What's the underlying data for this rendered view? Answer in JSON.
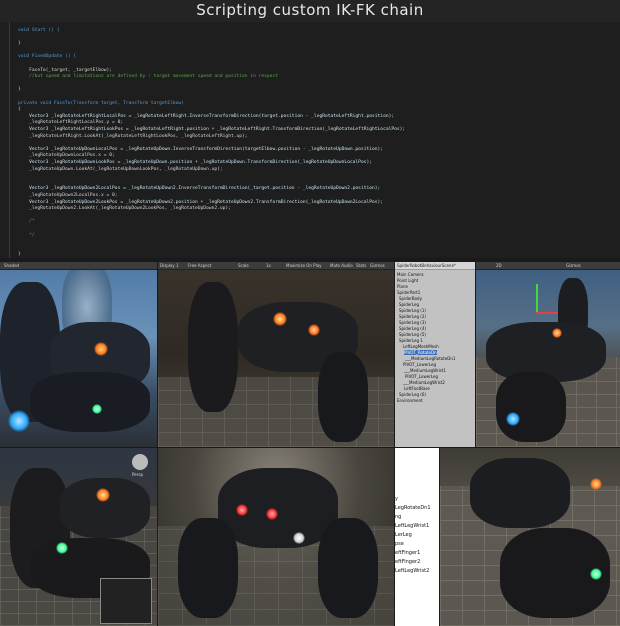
{
  "title": "Scripting custom IK-FK chain",
  "code_lines": [
    "void Start () {",
    "",
    "}",
    "",
    "void FixedUpdate () {",
    "",
    "    FaceTo(_target, _targetElbow);",
    "    //but speed and limitations are defined by : target movement speed and position in respect",
    "",
    "}",
    "",
    "private void FaceTo(Transform target, Transform targetElbow)",
    "{",
    "    Vector3 _legRotateLeftRightLocalPos = _legRotateLeftRight.InverseTransformDirection(target.position - _legRotateLeftRight.position);",
    "    _legRotateLeftRightLocalPos.y = 0;",
    "    Vector3 _legRotateLeftRightLookPos = _legRotateLeftRight.position + _legRotateLeftRight.TransformDirection(_legRotateLeftRightLocalPos);",
    "    _legRotateLeftRight.LookAt(_legRotateLeftRightLookPos, _legRotateLeftRight.up);",
    "",
    "    Vector3 _legRotateUpDownLocalPos = _legRotateUpDown.InverseTransformDirection(targetElbow.position - _legRotateUpDown.position);",
    "    _legRotateUpDownLocalPos.x = 0;",
    "    Vector3 _legRotateUpDownLookPos = _legRotateUpDown.position + _legRotateUpDown.TransformDirection(_legRotateUpDownLocalPos);",
    "    _legRotateUpDown.LookAt(_legRotateUpDownLookPos, _legRotateUpDown.up);",
    "",
    "",
    "    Vector3 _legRotateUpDown2LocalPos = _legRotateUpDown2.InverseTransformDirection(_target.position - _legRotateUpDown2.position);",
    "    _legRotateUpDown2LocalPos.x = 0;",
    "    Vector3 _legRotateUpDown2LookPos = _legRotateUpDown2.position + _legRotateUpDown2.TransformDirection(_legRotateUpDown2LocalPos);",
    "    _legRotateUpDown2.LookAt(_legRotateUpDown2LookPos, _legRotateUpDown2.up);",
    "",
    "    /*",
    "",
    "    */",
    "",
    "",
    "}"
  ],
  "scene_panels": {
    "top_left_toolbar": "Shaded",
    "top_mid_toolbar": [
      "Display 1",
      "Free Aspect",
      "Scale",
      "1x",
      "Maximize On Play",
      "Mute Audio",
      "Stats",
      "Gizmos"
    ],
    "top_right_toolbar": [
      "2D",
      "Gizmos"
    ],
    "bottom_left_label": "Persp"
  },
  "hierarchy": {
    "header": "SpiderRobotBehaviourScene*",
    "items": [
      "Main Camera",
      "Point Light",
      "Plane",
      "SpiderPart1",
      "SpiderBody",
      "SpiderLeg",
      "SpiderLeg (1)",
      "SpiderLeg (2)",
      "SpiderLeg (3)",
      "SpiderLeg (4)",
      "SpiderLeg (5)",
      "SpiderLeg 1",
      "LeftLegMeshMesh",
      "PIVOT_RotateDn",
      "___MediumLegRotateDn1",
      "PIVOT_LowerLeg",
      "___MediumLegWrist1",
      "PIVOT_LowerLeg",
      "___MediumLegWrist2",
      "LeftFootBase",
      "SpiderLeg (6)",
      "Environment"
    ],
    "selected_index": 13
  },
  "hierarchy2": {
    "items": [
      "y",
      "LegRotateDn1",
      "ng",
      "LeftLegWrist1",
      "LerLeg",
      "pse",
      "eftFinger1",
      "eftFinger2",
      "LeftLegWrist2"
    ]
  },
  "colors": {
    "code_bg": "#1e1e1e",
    "keyword": "#569cd6",
    "type": "#4ec9b0",
    "comment": "#57a64a",
    "glow_orange": "#ff7a1a",
    "glow_blue": "#2aa8ff",
    "glow_green": "#3cff9a",
    "sky_blue": "#3e6f9c"
  }
}
